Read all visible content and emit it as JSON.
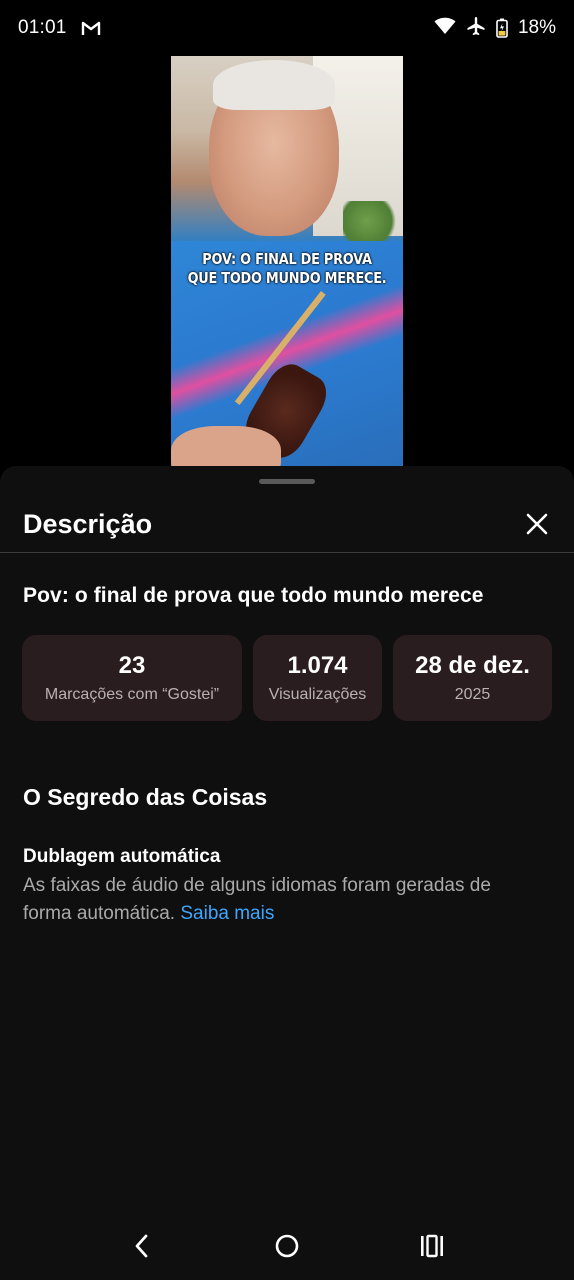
{
  "status_bar": {
    "time": "01:01",
    "battery_percent": "18%",
    "icons": [
      "gmail-icon",
      "wifi-icon",
      "airplane-mode-icon",
      "battery-icon"
    ]
  },
  "video": {
    "caption_line1": "POV: O FINAL DE PROVA",
    "caption_line2": "QUE TODO MUNDO MERECE."
  },
  "sheet": {
    "title": "Descrição",
    "video_title": "Pov: o final de prova que todo mundo merece",
    "stats": {
      "likes_value": "23",
      "likes_label": "Marcações com “Gostei”",
      "views_value": "1.074",
      "views_label": "Visualizações",
      "date_value": "28 de dez.",
      "date_year": "2025"
    },
    "channel_name": "O Segredo das Coisas",
    "dubbing": {
      "title": "Dublagem automática",
      "text": "As faixas de áudio de alguns idiomas foram geradas de forma automática.",
      "link": "Saiba mais"
    }
  },
  "colors": {
    "sheet_bg": "#0f0f0f",
    "stat_card_bg": "#2a1d20",
    "link": "#3ea6ff"
  }
}
